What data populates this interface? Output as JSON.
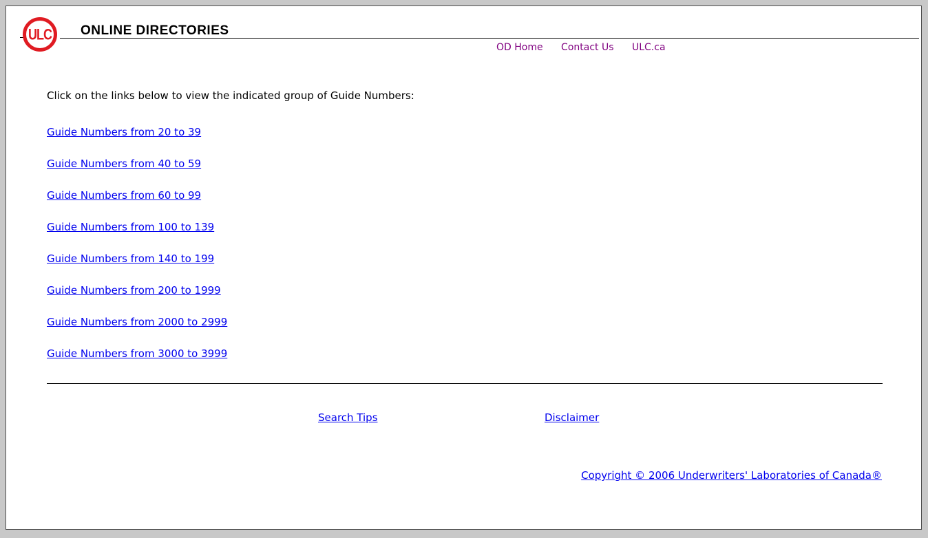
{
  "header": {
    "logo_text": "ULC",
    "title": "ONLINE DIRECTORIES",
    "links": [
      "OD Home",
      "Contact Us",
      "ULC.ca"
    ]
  },
  "main": {
    "intro": "Click on the links below to view the indicated group of Guide Numbers:",
    "guide_links": [
      "Guide Numbers from 20 to 39",
      "Guide Numbers from 40 to 59",
      "Guide Numbers from 60 to 99",
      "Guide Numbers from 100 to 139",
      "Guide Numbers from 140 to 199",
      "Guide Numbers from 200 to 1999",
      "Guide Numbers from 2000 to 2999",
      "Guide Numbers from 3000 to 3999"
    ]
  },
  "footer": {
    "search_tips": "Search Tips",
    "disclaimer": "Disclaimer",
    "copyright": "Copyright © 2006 Underwriters' Laboratories of Canada®"
  },
  "colors": {
    "logo_red": "#e01b22",
    "link_blue": "#0000ee",
    "visited_purple": "#800080"
  }
}
